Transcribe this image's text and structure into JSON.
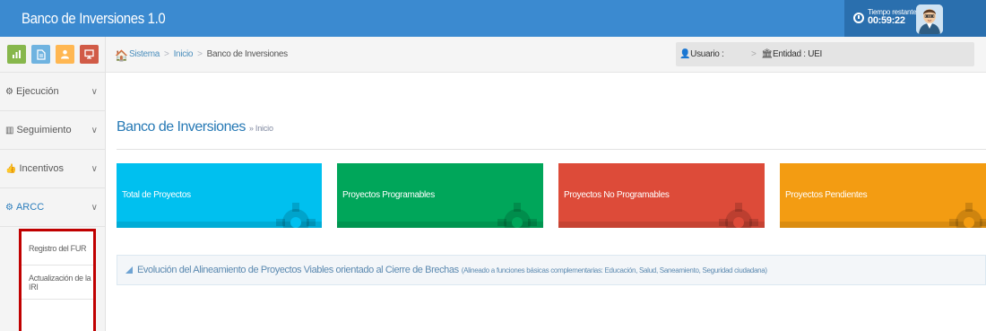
{
  "header": {
    "app_title": "Banco de Inversiones 1.0",
    "timer_label": "Tiempo restante",
    "timer_value": "00:59:22",
    "colors": {
      "bar": "#3b8ad0",
      "right_panel": "#2a6fae"
    }
  },
  "sidebar": {
    "shortcuts": [
      {
        "icon": "chart-icon",
        "color": "#87b74c"
      },
      {
        "icon": "file-icon",
        "color": "#6fb3e0"
      },
      {
        "icon": "users-icon",
        "color": "#ffb752"
      },
      {
        "icon": "desktop-icon",
        "color": "#d15b47"
      }
    ],
    "items": [
      {
        "label": "Ejecución",
        "icon": "cog-icon"
      },
      {
        "label": "Seguimiento",
        "icon": "bar-chart-icon"
      },
      {
        "label": "Incentivos",
        "icon": "thumbs-up-icon"
      },
      {
        "label": "ARCC",
        "icon": "cogs-icon",
        "active": true
      }
    ],
    "submenu": [
      {
        "label": "Registro del FUR"
      },
      {
        "label": "Actualización de la IRI"
      }
    ]
  },
  "breadcrumbs": {
    "items": [
      "Sistema",
      "Inicio",
      "Banco de Inversiones"
    ]
  },
  "userbox": {
    "user_label": "Usuario :",
    "entity_label": "Entidad : UEI"
  },
  "page": {
    "title": "Banco de Inversiones",
    "subtitle": "» Inicio"
  },
  "cards": [
    {
      "label": "Total de Proyectos",
      "color": "#00c0ef"
    },
    {
      "label": "Proyectos Programables",
      "color": "#00a65a"
    },
    {
      "label": "Proyectos No Programables",
      "color": "#dd4b39"
    },
    {
      "label": "Proyectos Pendientes",
      "color": "#f39c12"
    }
  ],
  "chart_section": {
    "title": "Evolución del Alineamiento de Proyectos Viables orientado al Cierre de Brechas",
    "subtitle": "(Alineado a funciones básicas complementarias: Educación, Salud, Saneamiento, Seguridad ciudadana)"
  }
}
